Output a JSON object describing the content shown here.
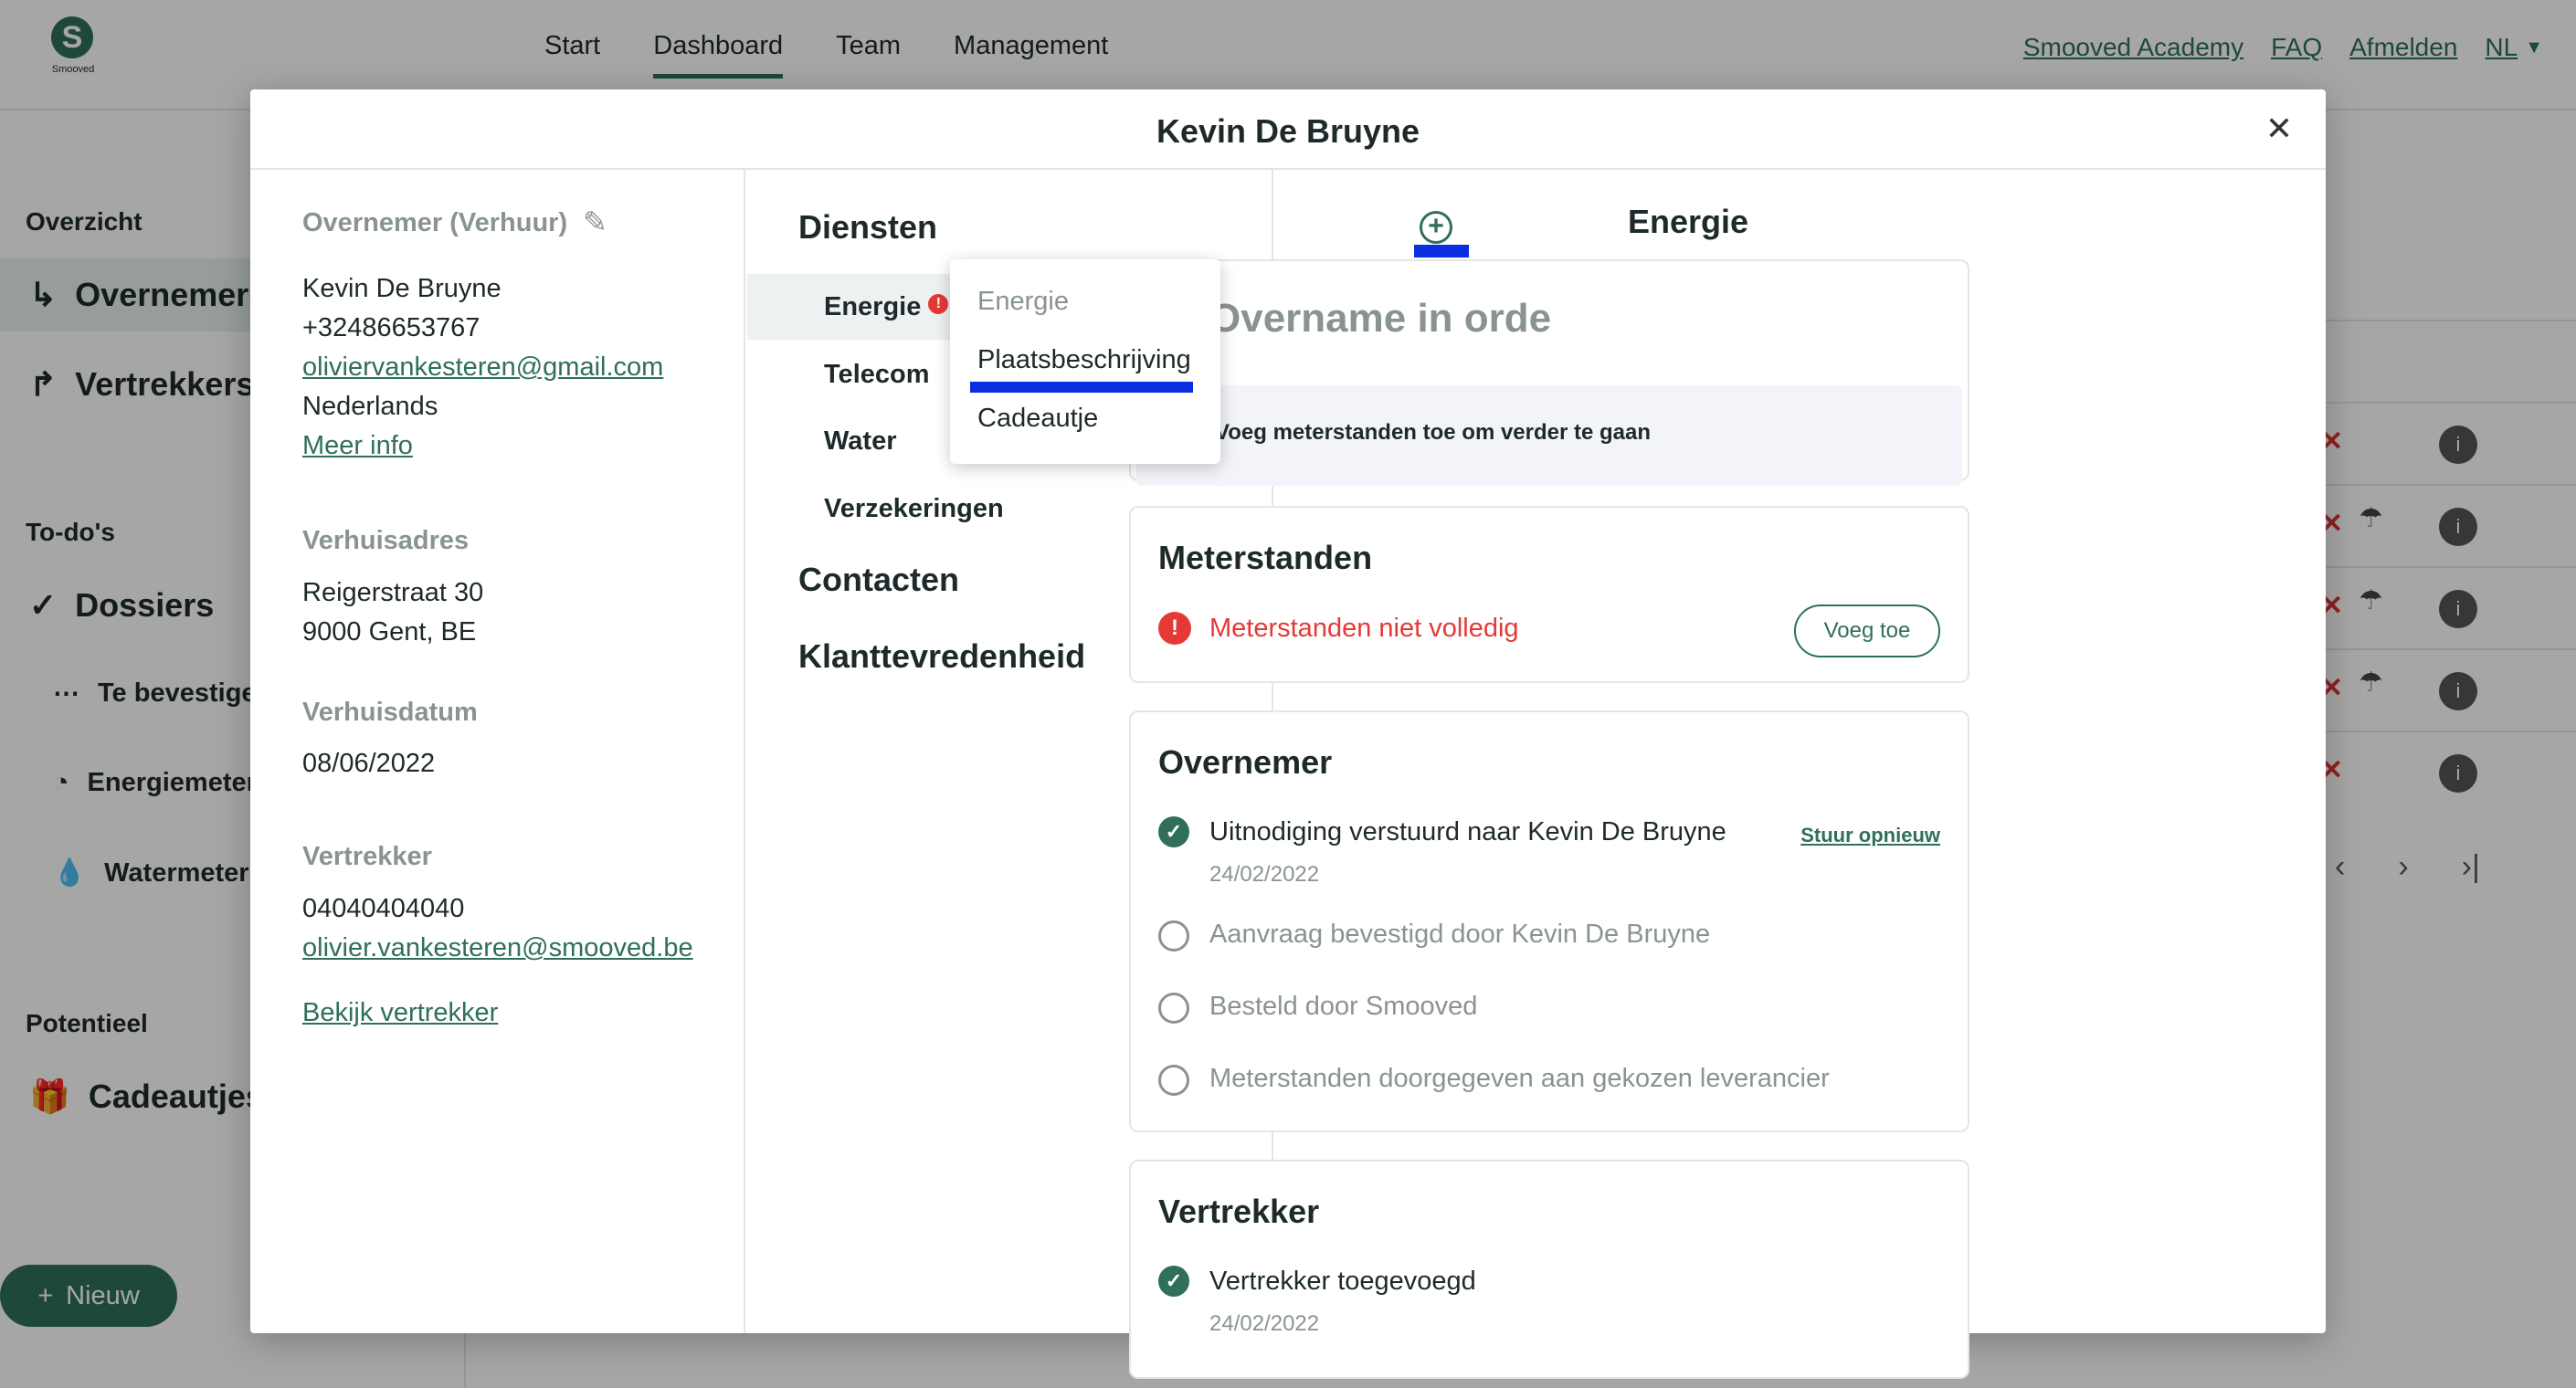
{
  "app": {
    "logo_text": "Smooved",
    "nav": {
      "start": "Start",
      "dashboard": "Dashboard",
      "team": "Team",
      "management": "Management"
    },
    "links": {
      "academy": "Smooved Academy",
      "faq": "FAQ",
      "logout": "Afmelden",
      "lang": "NL"
    }
  },
  "sidebar": {
    "overview_heading": "Overzicht",
    "overnemers": "Overnemers",
    "vertrekkers": "Vertrekkers",
    "todo_heading": "To-do's",
    "dossiers": "Dossiers",
    "sub": [
      "Te bevestigen",
      "Energiemeters",
      "Watermeters"
    ],
    "potential_heading": "Potentieel",
    "cadeautjes": "Cadeautjes",
    "new_button": "Nieuw"
  },
  "modal": {
    "title": "Kevin De Bruyne",
    "col1": {
      "section1_label": "Overnemer (Verhuur)",
      "name": "Kevin De Bruyne",
      "phone": "+32486653767",
      "email": "oliviervankesteren@gmail.com",
      "country": "Nederlands",
      "more_info": "Meer info",
      "address_label": "Verhuisadres",
      "address_line1": "Reigerstraat 30",
      "address_line2": "9000 Gent, BE",
      "date_label": "Verhuisdatum",
      "date": "08/06/2022",
      "leaver_label": "Vertrekker",
      "leaver_phone": "04040404040",
      "leaver_email": "olivier.vankesteren@smooved.be",
      "view_leaver": "Bekijk vertrekker"
    },
    "col2": {
      "services_heading": "Diensten",
      "services": [
        "Energie",
        "Telecom",
        "Water",
        "Verzekeringen"
      ],
      "contacts_heading": "Contacten",
      "satisfaction_heading": "Klanttevredenheid"
    },
    "dropdown": {
      "items": [
        "Energie",
        "Plaatsbeschrijving",
        "Cadeautje"
      ]
    },
    "col3": {
      "heading": "Energie",
      "status_title": "Overname in orde",
      "status_info": "Voeg meterstanden toe om verder te gaan",
      "meters_title": "Meterstanden",
      "meters_error": "Meterstanden niet volledig",
      "meters_add": "Voeg toe",
      "taker_title": "Overnemer",
      "taker_rows": [
        {
          "text": "Uitnodiging verstuurd naar Kevin De Bruyne",
          "date": "24/02/2022",
          "done": true
        },
        {
          "text": "Aanvraag bevestigd door Kevin De Bruyne",
          "done": false
        },
        {
          "text": "Besteld door Smooved",
          "done": false
        },
        {
          "text": "Meterstanden doorgegeven aan gekozen leverancier",
          "done": false
        }
      ],
      "resend": "Stuur opnieuw",
      "leaver_title": "Vertrekker",
      "leaver_row": {
        "text": "Vertrekker toegevoegd",
        "date": "24/02/2022",
        "done": true
      }
    }
  },
  "colors": {
    "brand": "#2f6f5c",
    "error": "#e53935",
    "info": "#4a56e0",
    "highlight": "#0b2fe0"
  }
}
